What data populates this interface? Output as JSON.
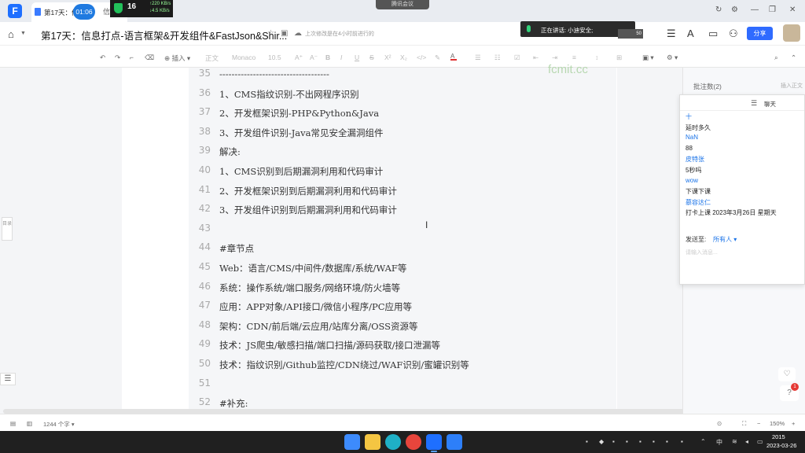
{
  "browser": {
    "tab_title": "第17天：信息打点-语言框架&开发组件&FastJson&Shir...",
    "tab_title_short": "第17天：信",
    "tab_suffix": "信...",
    "timer": "01:06",
    "net_cpu": "16",
    "net_up": "↑220 KB/s",
    "net_down": "↓4.5 KB/s",
    "meeting_label": "腾讯会议"
  },
  "header": {
    "doc_title": "第17天：信息打点-语言框架&开发组件&FastJson&Shir...",
    "save_status": "上次修改是在4小时前进行的",
    "speaking_label": "正在讲话: 小迪安全;",
    "avatar_count": "50",
    "share_label": "分享"
  },
  "toolbar": {
    "insert_label": "插入",
    "style_label": "正文",
    "font_label": "Monaco",
    "size_label": "10.5"
  },
  "document": {
    "watermark": "fcmit.cc",
    "lines": [
      {
        "num": "35",
        "text": "------------------------------------"
      },
      {
        "num": "36",
        "text": "1、CMS指纹识别-不出网程序识别"
      },
      {
        "num": "37",
        "text": "2、开发框架识别-PHP&Python&Java"
      },
      {
        "num": "38",
        "text": "3、开发组件识别-Java常见安全漏洞组件"
      },
      {
        "num": "39",
        "text": "解决:"
      },
      {
        "num": "40",
        "text": "1、CMS识别到后期漏洞利用和代码审计"
      },
      {
        "num": "41",
        "text": "2、开发框架识别到后期漏洞利用和代码审计"
      },
      {
        "num": "42",
        "text": "3、开发组件识别到后期漏洞利用和代码审计"
      },
      {
        "num": "43",
        "text": ""
      },
      {
        "num": "44",
        "text": "#章节点"
      },
      {
        "num": "45",
        "text": "Web：语言/CMS/中间件/数据库/系统/WAF等"
      },
      {
        "num": "46",
        "text": "系统：操作系统/端口服务/网络环境/防火墙等"
      },
      {
        "num": "47",
        "text": "应用：APP对象/API接口/微信小程序/PC应用等"
      },
      {
        "num": "48",
        "text": "架构：CDN/前后端/云应用/站库分离/OSS资源等"
      },
      {
        "num": "49",
        "text": "技术：JS爬虫/敏感扫描/端口扫描/源码获取/接口泄漏等"
      },
      {
        "num": "50",
        "text": "技术：指纹识别/Github监控/CDN绕过/WAF识别/蜜罐识别等"
      },
      {
        "num": "51",
        "text": ""
      },
      {
        "num": "52",
        "text": "#补充:"
      }
    ],
    "left_tab": "目录"
  },
  "comments": {
    "title": "批注数(2)",
    "add": "插入正文"
  },
  "chat": {
    "title": "聊天",
    "messages": [
      {
        "text": "十",
        "type": "name"
      },
      {
        "text": "延时多久",
        "type": "body"
      },
      {
        "text": "NaN",
        "type": "name"
      },
      {
        "text": "88",
        "type": "body"
      },
      {
        "text": "皮特张",
        "type": "name"
      },
      {
        "text": "5秒吗",
        "type": "body"
      },
      {
        "text": "wow",
        "type": "name"
      },
      {
        "text": "下课下课",
        "type": "body"
      },
      {
        "text": "慕容达仁",
        "type": "name"
      },
      {
        "text": "打卡上课 2023年3月26日 星期天",
        "type": "body"
      }
    ],
    "send_to_label": "发送至:",
    "send_to_value": "所有人 ▾",
    "input_placeholder": "请输入消息..."
  },
  "statusbar": {
    "word_count": "1244 个字 ▾",
    "zoom": "150%"
  },
  "taskbar": {
    "time": "2015",
    "date": "2023-03-26",
    "lang": "中"
  }
}
